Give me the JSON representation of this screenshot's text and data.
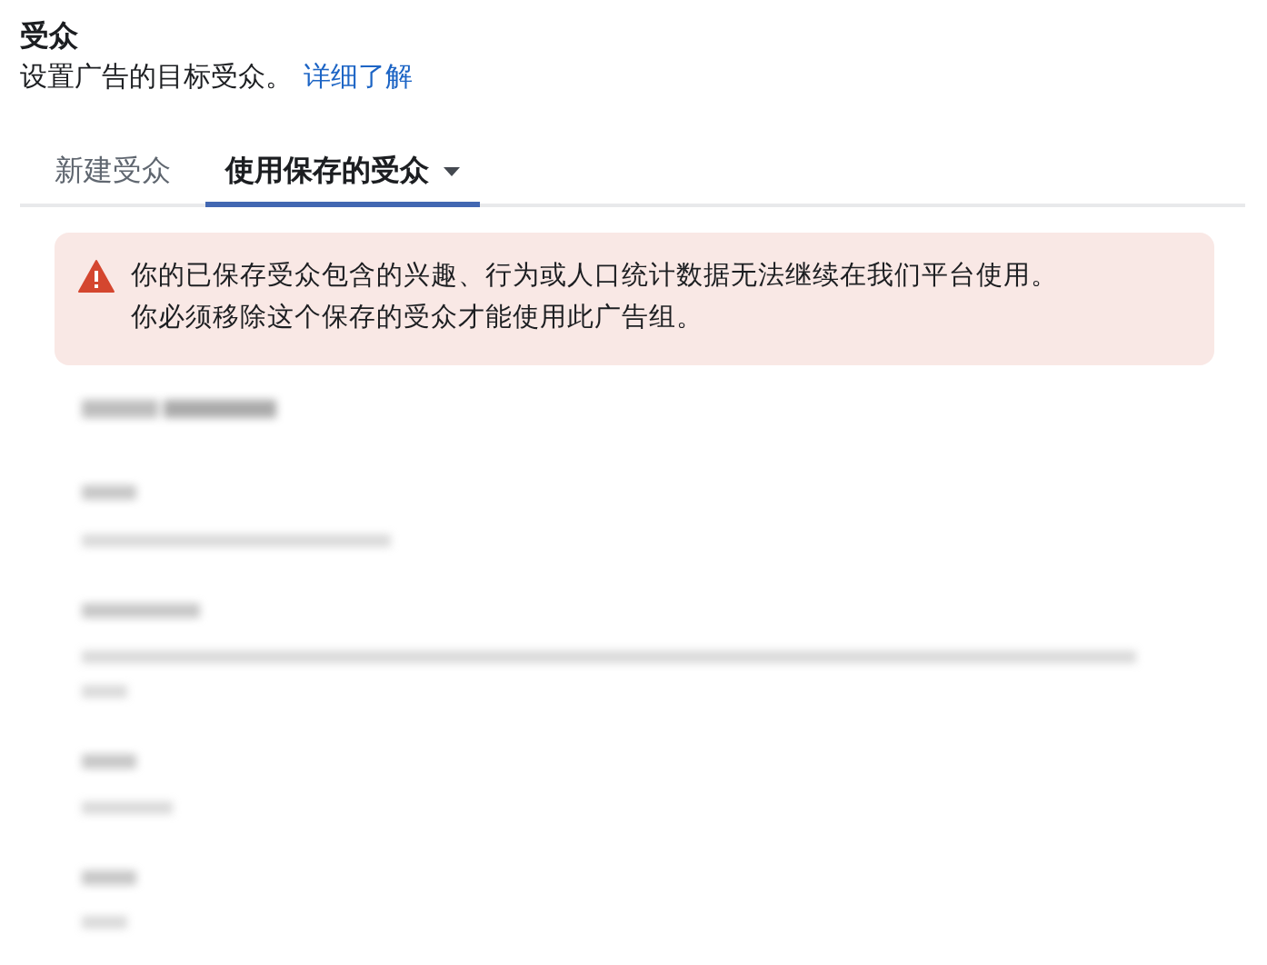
{
  "section": {
    "title": "受众",
    "description": "设置广告的目标受众。",
    "link": "详细了解"
  },
  "tabs": [
    {
      "label": "新建受众",
      "selected": false,
      "dropdown": false
    },
    {
      "label": "使用保存的受众",
      "selected": true,
      "dropdown": true
    }
  ],
  "alert": {
    "kind": "error",
    "lines": [
      "你的已保存受众包含的兴趣、行为或人口统计数据无法继续在我们平台使用。",
      "你必须移除这个保存的受众才能使用此广告组。"
    ]
  },
  "details": {
    "kind": "blurred"
  }
}
